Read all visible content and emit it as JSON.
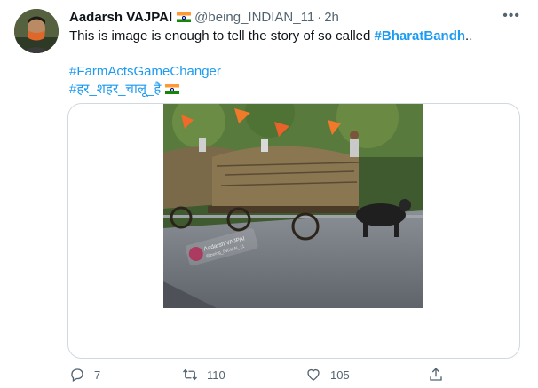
{
  "tweet": {
    "author_name": "Aadarsh VAJPAI",
    "handle": "@being_INDIAN_11",
    "separator": "·",
    "time": "2h",
    "more": "•••",
    "text_prefix": "This is image is enough to tell the story of so called ",
    "hashtag_inline": "#BharatBandh",
    "text_suffix": "..",
    "hashtag_farm": "#FarmActsGameChanger",
    "hashtag_hindi": "#हर_शहर_चालू_है"
  },
  "photo": {
    "watermark_name": "Aadarsh VAJPAI",
    "watermark_handle": "@being_INDIAN_11"
  },
  "actions": {
    "reply_count": "7",
    "retweet_count": "110",
    "like_count": "105"
  },
  "colors": {
    "link_blue": "#1d9bf0",
    "secondary_text": "#536471",
    "border": "#cfd9de"
  },
  "icons": [
    "reply-icon",
    "retweet-icon",
    "like-icon",
    "share-icon",
    "more-icon",
    "india-flag-icon"
  ]
}
